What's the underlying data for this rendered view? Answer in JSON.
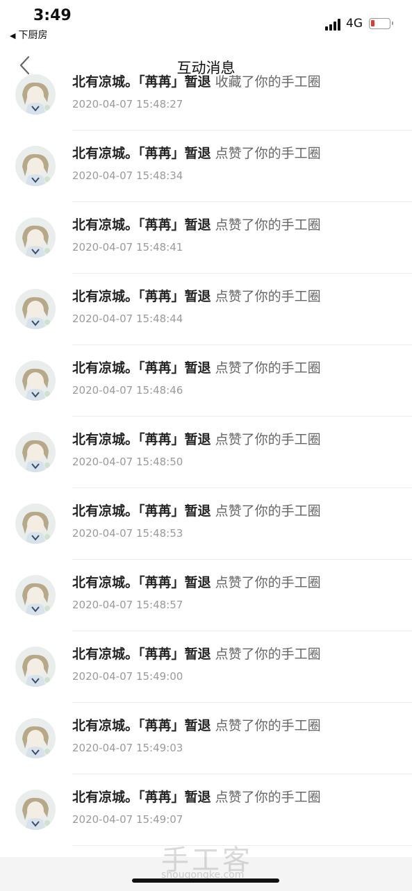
{
  "status_bar": {
    "time": "3:49",
    "back_app": "下厨房",
    "network": "4G",
    "battery_color": "#e03a33"
  },
  "nav": {
    "title": "互动消息",
    "back_icon": "chevron-left-icon"
  },
  "items": [
    {
      "user": "北有凉城。「苒苒」暂退",
      "action": "收藏了你的手工圈",
      "time": "2020-04-07 15:48:27"
    },
    {
      "user": "北有凉城。「苒苒」暂退",
      "action": "点赞了你的手工圈",
      "time": "2020-04-07 15:48:34"
    },
    {
      "user": "北有凉城。「苒苒」暂退",
      "action": "点赞了你的手工圈",
      "time": "2020-04-07 15:48:41"
    },
    {
      "user": "北有凉城。「苒苒」暂退",
      "action": "点赞了你的手工圈",
      "time": "2020-04-07 15:48:44"
    },
    {
      "user": "北有凉城。「苒苒」暂退",
      "action": "点赞了你的手工圈",
      "time": "2020-04-07 15:48:46"
    },
    {
      "user": "北有凉城。「苒苒」暂退",
      "action": "点赞了你的手工圈",
      "time": "2020-04-07 15:48:50"
    },
    {
      "user": "北有凉城。「苒苒」暂退",
      "action": "点赞了你的手工圈",
      "time": "2020-04-07 15:48:53"
    },
    {
      "user": "北有凉城。「苒苒」暂退",
      "action": "点赞了你的手工圈",
      "time": "2020-04-07 15:48:57"
    },
    {
      "user": "北有凉城。「苒苒」暂退",
      "action": "点赞了你的手工圈",
      "time": "2020-04-07 15:49:00"
    },
    {
      "user": "北有凉城。「苒苒」暂退",
      "action": "点赞了你的手工圈",
      "time": "2020-04-07 15:49:03"
    },
    {
      "user": "北有凉城。「苒苒」暂退",
      "action": "点赞了你的手工圈",
      "time": "2020-04-07 15:49:07"
    }
  ],
  "watermark": {
    "text": "手工客",
    "sub": "shougongke.com"
  }
}
